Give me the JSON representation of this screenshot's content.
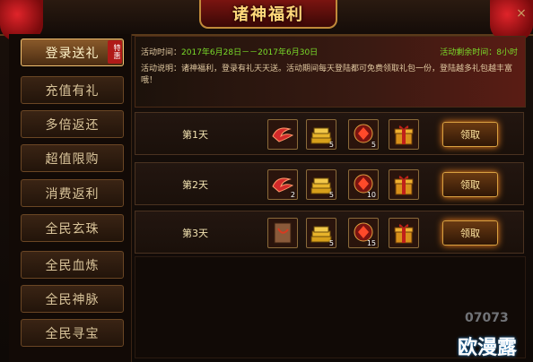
{
  "window": {
    "title": "诸神福利",
    "close_label": "×"
  },
  "sidebar": {
    "items": [
      {
        "label": "登录送礼",
        "active": true,
        "stamp": "特惠"
      },
      {
        "label": "充值有礼"
      },
      {
        "label": "多倍返还"
      },
      {
        "label": "超值限购"
      },
      {
        "label": "消费返利"
      },
      {
        "label": "全民玄珠"
      },
      {
        "label": "全民血炼"
      },
      {
        "label": "全民神脉"
      },
      {
        "label": "全民寻宝"
      }
    ]
  },
  "info": {
    "time_label": "活动时间：",
    "time_value": "2017年6月28日－－2017年6月30日",
    "remaining": "活动剩余时间：8小时",
    "description": "活动说明：诸神福利，登录有礼天天送。活动期间每天登陆都可免费领取礼包一份，登陆越多礼包越丰富哦！"
  },
  "rewards": [
    {
      "day": "第1天",
      "items": [
        {
          "icon": "red-wing-icon",
          "count": ""
        },
        {
          "icon": "gold-bars-icon",
          "count": "5"
        },
        {
          "icon": "red-gem-icon",
          "count": "5"
        },
        {
          "icon": "gift-box-icon",
          "count": ""
        }
      ],
      "claim": "领取"
    },
    {
      "day": "第2天",
      "items": [
        {
          "icon": "red-wing-icon",
          "count": "2"
        },
        {
          "icon": "gold-bars-icon",
          "count": "5"
        },
        {
          "icon": "red-gem-icon",
          "count": "10"
        },
        {
          "icon": "gift-box-icon",
          "count": ""
        }
      ],
      "claim": "领取"
    },
    {
      "day": "第3天",
      "items": [
        {
          "icon": "scroll-icon",
          "count": ""
        },
        {
          "icon": "gold-bars-icon",
          "count": "5"
        },
        {
          "icon": "red-gem-icon",
          "count": "15"
        },
        {
          "icon": "gift-box-icon",
          "count": ""
        }
      ],
      "claim": "领取"
    }
  ],
  "watermark": {
    "number": "07073",
    "text": "欧漫露"
  },
  "colors": {
    "accent_green": "#7adc2a",
    "gold": "#ffd87a",
    "active_border": "#f0c070"
  }
}
